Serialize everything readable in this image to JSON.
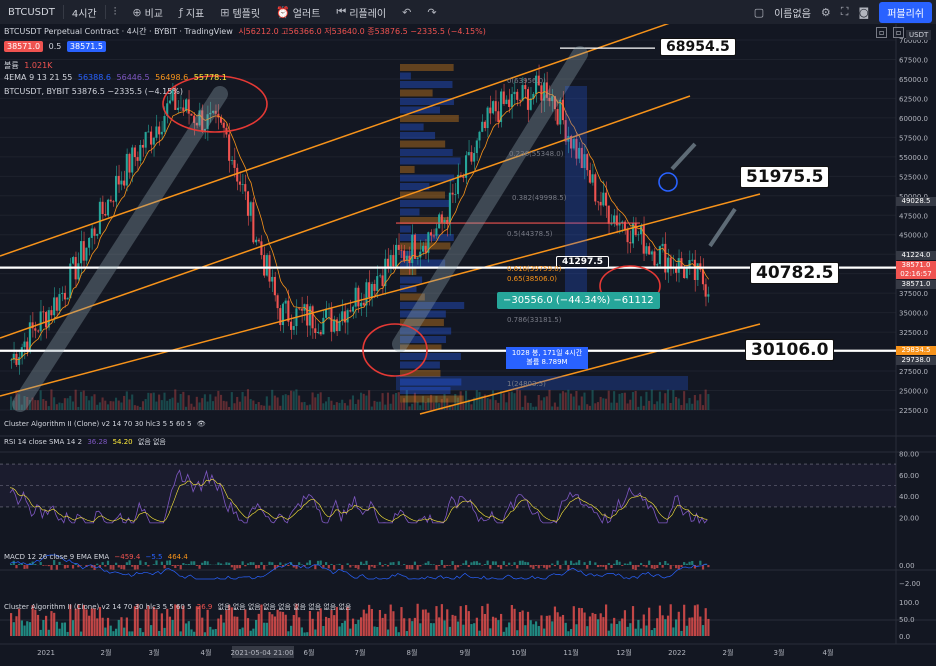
{
  "toolbar": {
    "symbol": "BTCUSDT",
    "interval": "4시간",
    "compare": "비교",
    "indicators": "지표",
    "templates": "템플릿",
    "alerts": "얼러트",
    "replay": "리플레이",
    "layout_name": "이름없음",
    "publish": "퍼블리쉬"
  },
  "legend": {
    "title": "BTCUSDT Perpetual Contract · 4시간 · BYBIT · TradingView",
    "ohlc": "시56212.0 고56366.0 저53640.0 종53876.5 −2335.5 (−4.15%)",
    "bid": "38571.0",
    "spread": "0.5",
    "ask": "38571.5",
    "volume_label": "볼륨",
    "volume_value": "1.021K",
    "ema_label": "4EMA 9 13 21 55",
    "ema_values": [
      "56388.6",
      "56446.5",
      "56498.6",
      "55778.1"
    ],
    "compare_line": "BTCUSDT, BYBIT  53876.5  −2335.5 (−4.15%)",
    "usdt": "USDT"
  },
  "colors": {
    "background": "#131722",
    "up": "#26a69a",
    "down": "#ef5350",
    "channel": "#f7931a",
    "rsi": "#7e57c2",
    "annotation_red": "#e53935"
  },
  "callouts": {
    "high": "68954.5",
    "mid": "51975.5",
    "current": "40782.5",
    "low": "30106.0",
    "measure": "−30556.0 (−44.34%) −61112",
    "range_box_line1": "1028 봉, 171일 4시간",
    "range_box_line2": "볼륨 8.789M",
    "box_label": "41297.5"
  },
  "fib_labels": [
    "0(63956.0)",
    "0.382(49998.5)",
    "0.5(44378.5)",
    "0.618(39759.0)",
    "0.65(38506.0)",
    "0.786(33181.5)",
    "1(24803.5)",
    "0.236(55348.0)"
  ],
  "price_tags": [
    {
      "price": "49028.5",
      "color": "#363a45"
    },
    {
      "price": "41224.0",
      "color": "#363a45"
    },
    {
      "price": "38571.0",
      "color": "#ef5350"
    },
    {
      "price": "02:16:57",
      "color": "#ef5350"
    },
    {
      "price": "38571.0",
      "color": "#363a45"
    },
    {
      "price": "29834.5",
      "color": "#f7931a"
    },
    {
      "price": "29738.0",
      "color": "#363a45"
    }
  ],
  "price_axis": [
    "70000.0",
    "67500.0",
    "65000.0",
    "62500.0",
    "60000.0",
    "57500.0",
    "55000.0",
    "52500.0",
    "50000.0",
    "47500.0",
    "45000.0",
    "42500.0",
    "40000.0",
    "37500.0",
    "35000.0",
    "32500.0",
    "30000.0",
    "27500.0",
    "25000.0",
    "22500.0"
  ],
  "panels": {
    "cluster_top": "Cluster Algorithm II (Clone) v2 14 70 30 hlc3 5 5 60 5",
    "rsi": "RSI 14 close SMA 14 2",
    "rsi_v1": "36.28",
    "rsi_v2": "54.20",
    "rsi_v3": "없음 없음",
    "rsi_axis": [
      "80.00",
      "60.00",
      "40.00",
      "20.00"
    ],
    "macd": "MACD 12 26 close 9 EMA EMA",
    "macd_v1": "−459.4",
    "macd_v2": "−5.5",
    "macd_v3": "464.4",
    "macd_axis": [
      "0.00",
      "−2.00"
    ],
    "cluster_bottom": "Cluster Algorithm II (Clone) v2 14 70 30 hlc3 5 5 60 5",
    "cluster_v1": "26.9",
    "cluster_v2": "없음 없음 없음 없음 없음 없음 없음 없음 없음",
    "cluster_axis": [
      "100.0",
      "50.0",
      "0.0"
    ]
  },
  "time_axis": [
    "2021",
    "2월",
    "3월",
    "4월",
    "2021-05-04  21:00",
    "6월",
    "7월",
    "8월",
    "9월",
    "10월",
    "11월",
    "12월",
    "2022",
    "2월",
    "3월",
    "4월"
  ],
  "chart_data": {
    "type": "line",
    "title": "BTCUSDT Perpetual Contract · 4시간 · BYBIT",
    "x": [
      "2021",
      "2월",
      "3월",
      "4월",
      "5월",
      "6월",
      "7월",
      "8월",
      "9월",
      "10월",
      "11월",
      "12월",
      "2022",
      "2월"
    ],
    "series": [
      {
        "name": "BTCUSDT",
        "values": [
          29000,
          38000,
          52000,
          62000,
          58000,
          35000,
          34000,
          41000,
          46000,
          61000,
          64000,
          49000,
          43000,
          38571
        ]
      }
    ],
    "ylim": [
      22500,
      70000
    ],
    "levels": [
      68954.5,
      51975.5,
      40782.5,
      30106.0
    ]
  }
}
